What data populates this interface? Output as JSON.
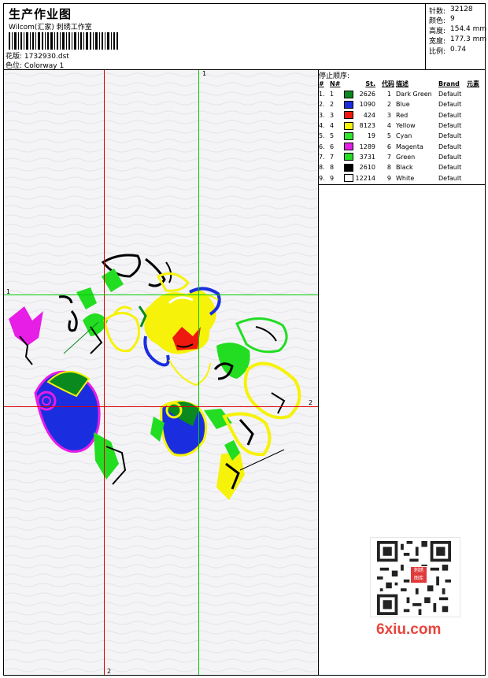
{
  "header": {
    "title": "生产作业图",
    "company": "Wilcom(汇家) 刺绣工作室",
    "design_label": "花版:",
    "design_value": "1732930.dst",
    "colorway_label": "色位:",
    "colorway_value": "Colorway 1"
  },
  "stats": {
    "stitches": {
      "label": "针数:",
      "value": "32128"
    },
    "colors": {
      "label": "颜色:",
      "value": "9"
    },
    "height": {
      "label": "高度:",
      "value": "154.4 mm"
    },
    "width": {
      "label": "宽度:",
      "value": "177.3 mm"
    },
    "scale": {
      "label": "比例:",
      "value": "0.74"
    }
  },
  "stop_sequence": {
    "label": "停止顺序:",
    "headers": {
      "index": "#",
      "needle": "N#",
      "stitches": "St.",
      "code": "代码",
      "description": "描述",
      "brand": "Brand",
      "element": "元素"
    },
    "rows": [
      {
        "index": "1.",
        "needle": "1",
        "color": "#0a8a1e",
        "stitches": "2626",
        "code": "1",
        "description": "Dark Green",
        "brand": "Default"
      },
      {
        "index": "2.",
        "needle": "2",
        "color": "#1a2ee0",
        "stitches": "1090",
        "code": "2",
        "description": "Blue",
        "brand": "Default"
      },
      {
        "index": "3.",
        "needle": "3",
        "color": "#ee1a10",
        "stitches": "424",
        "code": "3",
        "description": "Red",
        "brand": "Default"
      },
      {
        "index": "4.",
        "needle": "4",
        "color": "#f6f20a",
        "stitches": "8123",
        "code": "4",
        "description": "Yellow",
        "brand": "Default"
      },
      {
        "index": "5.",
        "needle": "5",
        "color": "#2ee62e",
        "stitches": "19",
        "code": "5",
        "description": "Cyan",
        "brand": "Default"
      },
      {
        "index": "6.",
        "needle": "6",
        "color": "#e61ee6",
        "stitches": "1289",
        "code": "6",
        "description": "Magenta",
        "brand": "Default"
      },
      {
        "index": "7.",
        "needle": "7",
        "color": "#22dd22",
        "stitches": "3731",
        "code": "7",
        "description": "Green",
        "brand": "Default"
      },
      {
        "index": "8.",
        "needle": "8",
        "color": "#000000",
        "stitches": "2610",
        "code": "8",
        "description": "Black",
        "brand": "Default"
      },
      {
        "index": "9.",
        "needle": "9",
        "color": "#ffffff",
        "stitches": "12214",
        "code": "9",
        "description": "White",
        "brand": "Default"
      }
    ]
  },
  "canvas": {
    "axis_labels": {
      "v1": "1",
      "v2": "2",
      "h1": "1",
      "h2": "2"
    },
    "colors": {
      "red_line": "#dd0000",
      "green_line": "#00cc00",
      "background": "#f4f4f6"
    }
  },
  "watermark": {
    "text": "6xiu.com",
    "seal_text": "刺绣图库"
  }
}
